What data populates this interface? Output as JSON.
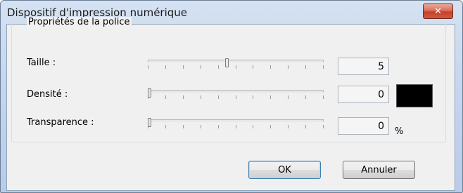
{
  "window": {
    "title": "Dispositif d'impression numérique",
    "close_icon": "close-icon"
  },
  "group": {
    "label": "Propriétés de la police"
  },
  "rows": [
    {
      "label": "Taille :",
      "value": "5",
      "slider_fraction": 0.45
    },
    {
      "label": "Densité :",
      "value": "0",
      "slider_fraction": 0.0
    },
    {
      "label": "Transparence :",
      "value": "0",
      "slider_fraction": 0.0
    }
  ],
  "density_color": "#000000",
  "transparency_unit": "%",
  "buttons": {
    "ok": "OK",
    "cancel": "Annuler"
  },
  "colors": {
    "titlebar": "#c6d7ee",
    "close_button": "#c7402a",
    "client_bg": "#f0f0f0"
  }
}
